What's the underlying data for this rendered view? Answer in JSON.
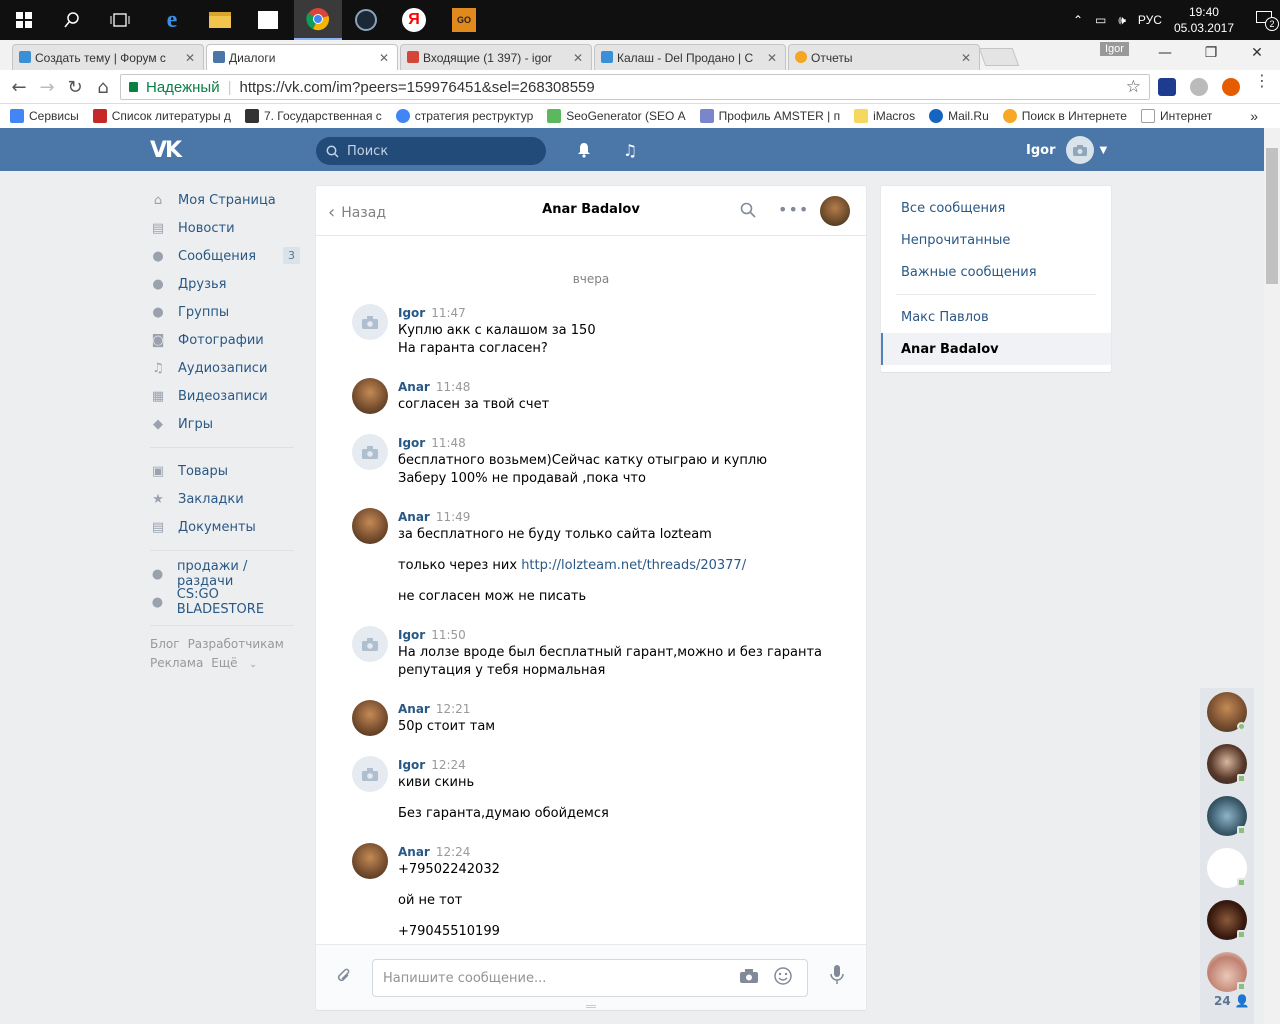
{
  "taskbar": {
    "lang": "РУС",
    "time": "19:40",
    "date": "05.03.2017",
    "notification_count": "2"
  },
  "browser": {
    "tabs": [
      {
        "title": "Создать тему | Форум с",
        "color": "#3a8fd6"
      },
      {
        "title": "Диалоги",
        "color": "#4a76a8"
      },
      {
        "title": "Входящие (1 397) - igor",
        "color": "#d44638"
      },
      {
        "title": "Калаш - Del Продано | С",
        "color": "#3a8fd6"
      },
      {
        "title": "Отчеты",
        "color": "#f4a623"
      }
    ],
    "profile_badge": "Igor",
    "secure_label": "Надежный",
    "url": "https://vk.com/im?peers=159976451&sel=268308559",
    "bookmarks": [
      {
        "label": "Сервисы",
        "color": "#4285f4"
      },
      {
        "label": "Список литературы д",
        "color": "#c62828"
      },
      {
        "label": "7. Государственная с",
        "color": "#333333"
      },
      {
        "label": "стратегия реструктур",
        "color": "#4285f4"
      },
      {
        "label": "SeoGenerator (SEO А",
        "color": "#5cb85c"
      },
      {
        "label": "Профиль AMSTER | п",
        "color": "#7986cb"
      },
      {
        "label": "iMacros",
        "color": "#f6d860"
      },
      {
        "label": "Mail.Ru",
        "color": "#1565c0"
      },
      {
        "label": "Поиск в Интернете",
        "color": "#f9a825"
      },
      {
        "label": "Интернет",
        "color": "#9e9e9e"
      }
    ]
  },
  "vk": {
    "logo": "VK",
    "search_placeholder": "Поиск",
    "user_name": "Igor",
    "nav": [
      {
        "label": "Моя Страница",
        "icon": "home-icon",
        "glyph": "⌂"
      },
      {
        "label": "Новости",
        "icon": "news-icon",
        "glyph": "▤"
      },
      {
        "label": "Сообщения",
        "icon": "messages-icon",
        "glyph": "●",
        "count": "3"
      },
      {
        "label": "Друзья",
        "icon": "friends-icon",
        "glyph": "●"
      },
      {
        "label": "Группы",
        "icon": "groups-icon",
        "glyph": "●"
      },
      {
        "label": "Фотографии",
        "icon": "photos-icon",
        "glyph": "◙"
      },
      {
        "label": "Аудиозаписи",
        "icon": "music-icon",
        "glyph": "♫"
      },
      {
        "label": "Видеозаписи",
        "icon": "video-icon",
        "glyph": "▦"
      },
      {
        "label": "Игры",
        "icon": "games-icon",
        "glyph": "◆"
      }
    ],
    "nav2": [
      {
        "label": "Товары",
        "icon": "goods-icon",
        "glyph": "▣"
      },
      {
        "label": "Закладки",
        "icon": "bookmarks-icon",
        "glyph": "★"
      },
      {
        "label": "Документы",
        "icon": "documents-icon",
        "glyph": "▤"
      }
    ],
    "nav3": [
      {
        "label": "продажи / раздачи",
        "icon": "community-icon",
        "glyph": "●"
      },
      {
        "label": "CS:GO BLADESTORE",
        "icon": "community-icon",
        "glyph": "●"
      }
    ],
    "footer": {
      "blog": "Блог",
      "dev": "Разработчикам",
      "ads": "Реклама",
      "more": "Ещё"
    }
  },
  "dialog": {
    "back_label": "Назад",
    "title": "Anar Badalov",
    "day_label": "вчера",
    "input_placeholder": "Напишите сообщение...",
    "messages": [
      {
        "author": "Igor",
        "kind": "igor",
        "time": "11:47",
        "lines": [
          "Куплю акк с калашом за 150",
          "На гаранта согласен?"
        ]
      },
      {
        "author": "Anar",
        "kind": "anar",
        "time": "11:48",
        "lines": [
          "согласен за твой счет"
        ]
      },
      {
        "author": "Igor",
        "kind": "igor",
        "time": "11:48",
        "lines": [
          "бесплатного возьмем)Сейчас катку отыграю и куплю",
          "Заберу 100% не продавай ,пока что"
        ]
      },
      {
        "author": "Anar",
        "kind": "anar",
        "time": "11:49",
        "lines": [
          "за бесплатного не буду только сайта lozteam",
          "только через них ",
          "не согласен мож не писать"
        ],
        "link": "http://lolzteam.net/threads/20377/"
      },
      {
        "author": "Igor",
        "kind": "igor",
        "time": "11:50",
        "lines": [
          "На лолзе вроде был бесплатный гарант,можно и без гаранта",
          "репутация у тебя нормальная"
        ]
      },
      {
        "author": "Anar",
        "kind": "anar",
        "time": "12:21",
        "lines": [
          "50р стоит там"
        ]
      },
      {
        "author": "Igor",
        "kind": "igor",
        "time": "12:24",
        "lines": [
          "киви скинь",
          "Без гаранта,думаю обойдемся"
        ]
      },
      {
        "author": "Anar",
        "kind": "anar",
        "time": "12:24",
        "lines": [
          "+79502242032",
          "ой не тот",
          "+79045510199"
        ]
      }
    ]
  },
  "folders": {
    "all": "Все сообщения",
    "unread": "Непрочитанные",
    "important": "Важные сообщения",
    "peer1": "Макс Павлов",
    "peer2": "Anar Badalov"
  },
  "online": {
    "count": "24"
  }
}
